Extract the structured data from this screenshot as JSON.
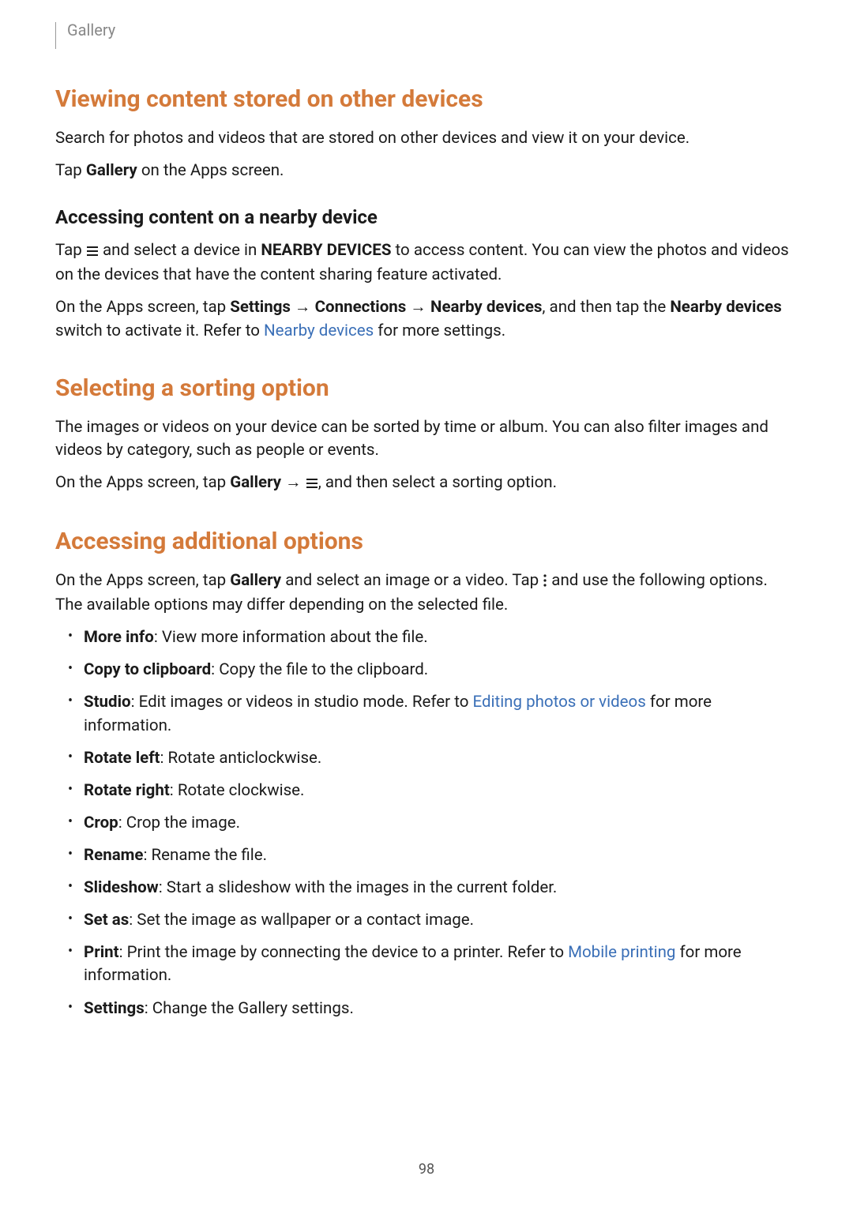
{
  "header": {
    "section_label": "Gallery"
  },
  "s1": {
    "title": "Viewing content stored on other devices",
    "p1": "Search for photos and videos that are stored on other devices and view it on your device.",
    "p2_a": "Tap ",
    "p2_b": "Gallery",
    "p2_c": " on the Apps screen.",
    "sub1": {
      "title": "Accessing content on a nearby device",
      "p1_a": "Tap ",
      "p1_b": " and select a device in ",
      "p1_c": "NEARBY DEVICES",
      "p1_d": " to access content. You can view the photos and videos on the devices that have the content sharing feature activated.",
      "p2_a": "On the Apps screen, tap ",
      "p2_b": "Settings",
      "p2_c": " → ",
      "p2_d": "Connections",
      "p2_e": " → ",
      "p2_f": "Nearby devices",
      "p2_g": ", and then tap the ",
      "p2_h": "Nearby devices",
      "p2_i": " switch to activate it. Refer to ",
      "p2_link": "Nearby devices",
      "p2_j": " for more settings."
    }
  },
  "s2": {
    "title": "Selecting a sorting option",
    "p1": "The images or videos on your device can be sorted by time or album. You can also filter images and videos by category, such as people or events.",
    "p2_a": "On the Apps screen, tap ",
    "p2_b": "Gallery",
    "p2_c": " → ",
    "p2_d": ", and then select a sorting option."
  },
  "s3": {
    "title": "Accessing additional options",
    "p1_a": "On the Apps screen, tap ",
    "p1_b": "Gallery",
    "p1_c": " and select an image or a video. Tap ",
    "p1_d": " and use the following options. The available options may differ depending on the selected file.",
    "items": [
      {
        "name": "More info",
        "desc": ": View more information about the file."
      },
      {
        "name": "Copy to clipboard",
        "desc": ": Copy the file to the clipboard."
      },
      {
        "name": "Studio",
        "desc_a": ": Edit images or videos in studio mode. Refer to ",
        "link": "Editing photos or videos",
        "desc_b": " for more information."
      },
      {
        "name": "Rotate left",
        "desc": ": Rotate anticlockwise."
      },
      {
        "name": "Rotate right",
        "desc": ": Rotate clockwise."
      },
      {
        "name": "Crop",
        "desc": ": Crop the image."
      },
      {
        "name": "Rename",
        "desc": ": Rename the file."
      },
      {
        "name": "Slideshow",
        "desc": ": Start a slideshow with the images in the current folder."
      },
      {
        "name": "Set as",
        "desc": ": Set the image as wallpaper or a contact image."
      },
      {
        "name": "Print",
        "desc_a": ": Print the image by connecting the device to a printer. Refer to ",
        "link": "Mobile printing",
        "desc_b": " for more information."
      },
      {
        "name": "Settings",
        "desc": ": Change the Gallery settings."
      }
    ]
  },
  "page_number": "98"
}
